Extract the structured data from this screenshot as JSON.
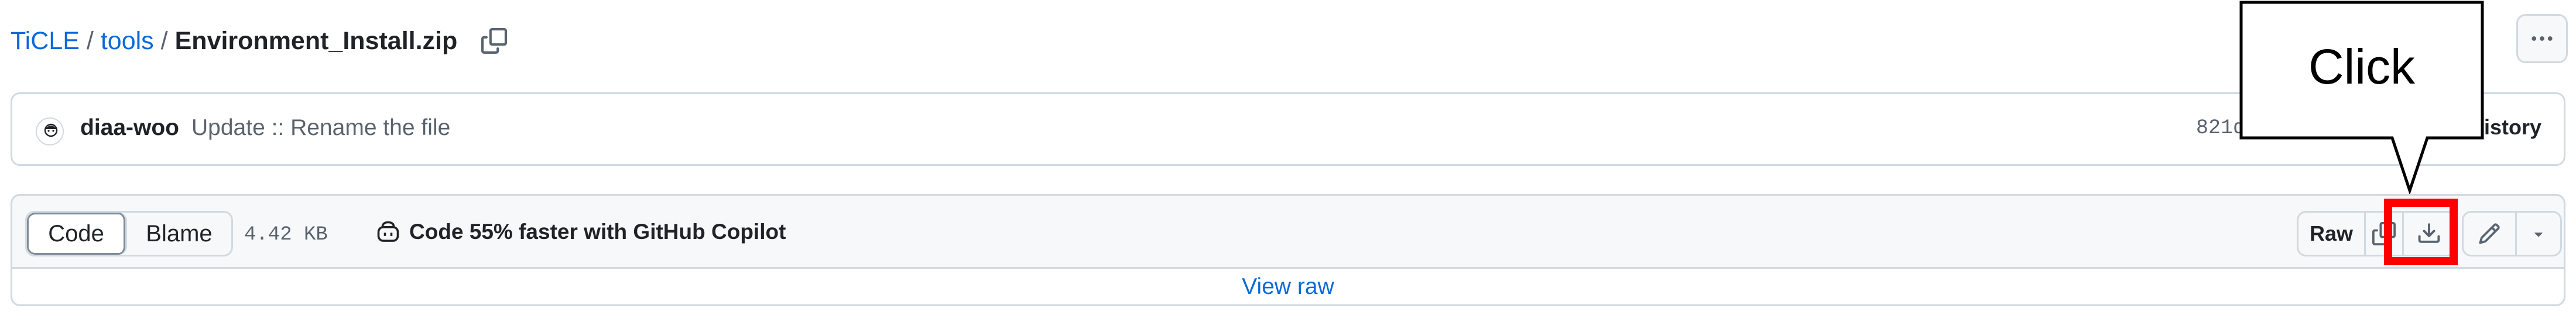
{
  "breadcrumb": {
    "repo": "TiCLE",
    "separator": "/",
    "folder": "tools",
    "file": "Environment_Install.zip",
    "copy_icon": "copy-icon"
  },
  "header": {
    "more_icon": "kebab-horizontal-icon"
  },
  "commit": {
    "author": "diaa-woo",
    "message": "Update :: Rename the file",
    "sha": "821d",
    "history_label": "History",
    "history_icon": "history-icon"
  },
  "file_toolbar": {
    "tabs": [
      {
        "label": "Code",
        "selected": true
      },
      {
        "label": "Blame",
        "selected": false
      }
    ],
    "size": "4.42 KB",
    "copilot_label": "Code 55% faster with GitHub Copilot",
    "copilot_icon": "copilot-icon",
    "raw_label": "Raw",
    "copy_raw_icon": "copy-icon",
    "download_icon": "download-icon",
    "edit_icon": "pencil-icon",
    "more_edit_icon": "triangle-down-icon"
  },
  "body": {
    "view_raw_label": "View raw"
  },
  "annotation": {
    "callout_text": "Click",
    "highlight_color": "#ff0000"
  },
  "colors": {
    "link": "#0969da",
    "muted": "#59636e",
    "border": "#d1d9e0",
    "subtle_bg": "#f6f8fa"
  }
}
